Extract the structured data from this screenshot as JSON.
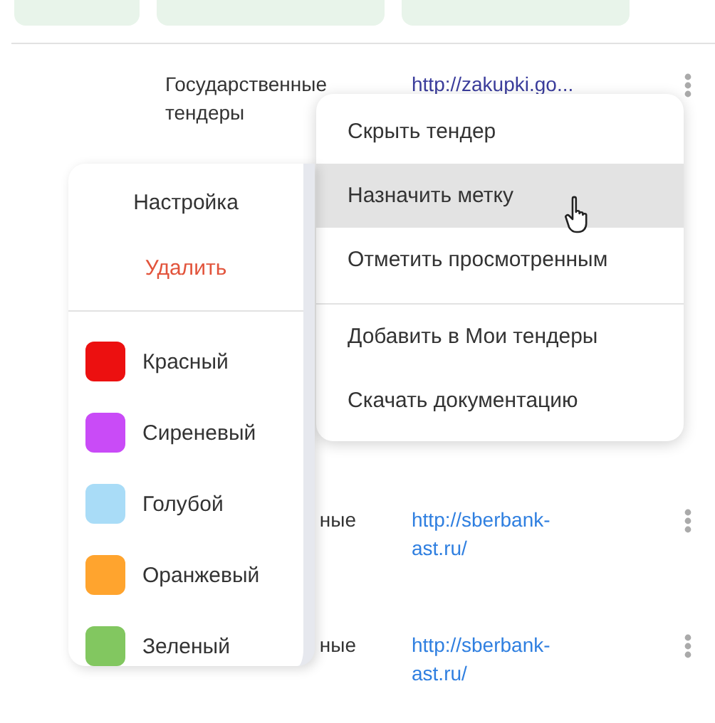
{
  "filter_chips": [
    {
      "kind": "chip"
    },
    {
      "kind": "chip"
    },
    {
      "kind": "chip"
    }
  ],
  "rows": [
    {
      "type": "Государственные тендеры",
      "link": "http://zakupki.go...",
      "visited": true
    },
    {
      "type": "ные",
      "link": "http://sberbank-ast.ru/",
      "visited": false
    },
    {
      "type": "ные",
      "link": "http://sberbank-ast.ru/",
      "visited": false
    }
  ],
  "context_menu": {
    "items": [
      {
        "label": "Скрыть тендер",
        "highlighted": false
      },
      {
        "label": "Назначить метку",
        "highlighted": true
      },
      {
        "label": "Отметить просмотренным",
        "highlighted": false
      },
      {
        "label": "Добавить в Мои тендеры",
        "highlighted": false,
        "divider_before": true
      },
      {
        "label": "Скачать документацию",
        "highlighted": false
      }
    ]
  },
  "label_menu": {
    "actions": [
      {
        "label": "Настройка",
        "danger": false
      },
      {
        "label": "Удалить",
        "danger": true
      }
    ],
    "labels": [
      {
        "label": "Красный",
        "color": "#ec1010"
      },
      {
        "label": "Сиреневый",
        "color": "#c94bf7"
      },
      {
        "label": "Голубой",
        "color": "#a9dcf7"
      },
      {
        "label": "Оранжевый",
        "color": "#ffa42e"
      },
      {
        "label": "Зеленый",
        "color": "#82c760"
      }
    ]
  }
}
